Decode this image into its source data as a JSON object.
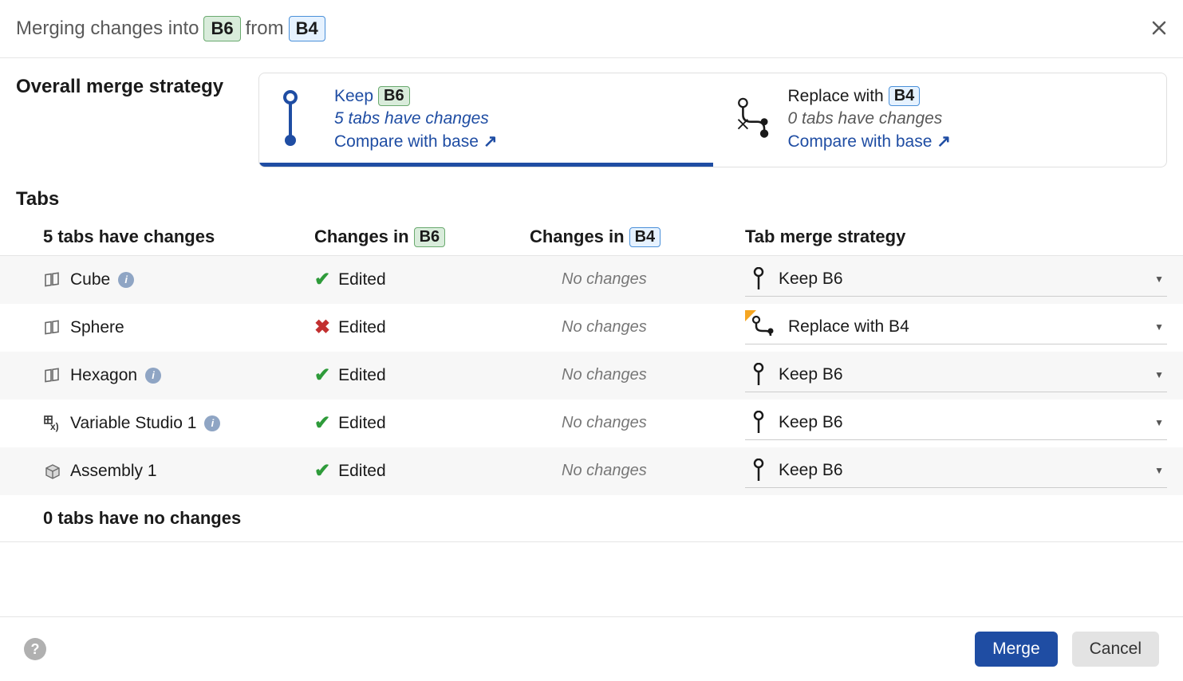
{
  "header": {
    "prefix": "Merging changes into",
    "into_branch": "B6",
    "middle": "from",
    "from_branch": "B4"
  },
  "strategy": {
    "label": "Overall merge strategy",
    "keep": {
      "title_prefix": "Keep",
      "branch": "B6",
      "sub": "5 tabs have changes",
      "compare": "Compare with base"
    },
    "replace": {
      "title_prefix": "Replace with",
      "branch": "B4",
      "sub": "0 tabs have changes",
      "compare": "Compare with base"
    }
  },
  "tabs_section": {
    "label": "Tabs",
    "columns": {
      "changes_count": "5 tabs have changes",
      "changes_in_prefix1": "Changes in",
      "changes_in_branch1": "B6",
      "changes_in_prefix2": "Changes in",
      "changes_in_branch2": "B4",
      "tab_strategy": "Tab merge strategy"
    },
    "rows": [
      {
        "name": "Cube",
        "icon": "part",
        "info": true,
        "status1": "Edited",
        "status1_icon": "check",
        "status2": "No changes",
        "strategy": "Keep B6",
        "strategy_icon": "keep",
        "flag": false
      },
      {
        "name": "Sphere",
        "icon": "part",
        "info": false,
        "status1": "Edited",
        "status1_icon": "x",
        "status2": "No changes",
        "strategy": "Replace with B4",
        "strategy_icon": "replace",
        "flag": true
      },
      {
        "name": "Hexagon",
        "icon": "part",
        "info": true,
        "status1": "Edited",
        "status1_icon": "check",
        "status2": "No changes",
        "strategy": "Keep B6",
        "strategy_icon": "keep",
        "flag": false
      },
      {
        "name": "Variable Studio 1",
        "icon": "variable",
        "info": true,
        "status1": "Edited",
        "status1_icon": "check",
        "status2": "No changes",
        "strategy": "Keep B6",
        "strategy_icon": "keep",
        "flag": false
      },
      {
        "name": "Assembly 1",
        "icon": "assembly",
        "info": false,
        "status1": "Edited",
        "status1_icon": "check",
        "status2": "No changes",
        "strategy": "Keep B6",
        "strategy_icon": "keep",
        "flag": false
      }
    ],
    "no_changes_heading": "0 tabs have no changes"
  },
  "footer": {
    "merge": "Merge",
    "cancel": "Cancel"
  }
}
